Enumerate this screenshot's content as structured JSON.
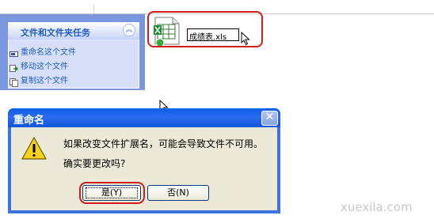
{
  "task_pane": {
    "title": "文件和文件夹任务",
    "items": [
      {
        "label": "重命名这个文件",
        "icon": "rename-icon"
      },
      {
        "label": "移动这个文件",
        "icon": "move-icon"
      },
      {
        "label": "复制这个文件",
        "icon": "copy-icon"
      }
    ],
    "collapse_icon": "double-chevron-up-icon",
    "collapse_glyph": "︽"
  },
  "file": {
    "icon": "excel-file-icon",
    "rename_value": "成绩表.xls"
  },
  "dialog": {
    "title": "重命名",
    "close_glyph": "✕",
    "message_line1": "如果改变文件扩展名，可能会导致文件不可用。",
    "message_line2": "确实要更改吗?",
    "icon": "warning-icon",
    "yes_label": "是(Y)",
    "no_label": "否(N)"
  },
  "watermark": "xuexila.com",
  "colors": {
    "highlight_ring": "#d11c1c",
    "title_bar": "#0a5ee8",
    "task_link": "#215dc6",
    "dialog_face": "#ece9d8"
  }
}
